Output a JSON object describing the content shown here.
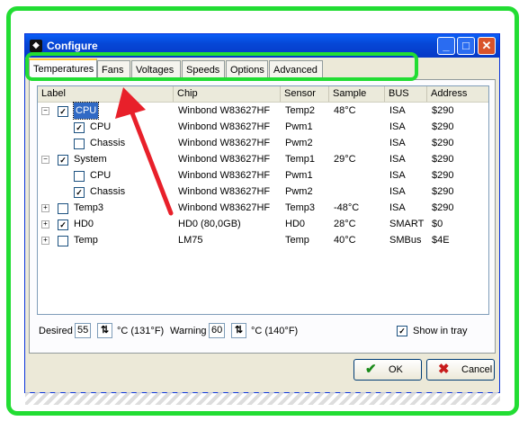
{
  "window": {
    "title": "Configure",
    "minimize": "_",
    "maximize": "□",
    "close": "✕"
  },
  "tabs": [
    "Temperatures",
    "Fans",
    "Voltages",
    "Speeds",
    "Options",
    "Advanced"
  ],
  "active_tab": "Temperatures",
  "columns": [
    "Label",
    "Chip",
    "Sensor",
    "Sample",
    "BUS",
    "Address"
  ],
  "rows": [
    {
      "label": "CPU",
      "level": 0,
      "expander": "−",
      "checked": true,
      "selected": true,
      "chip": "Winbond W83627HF",
      "sensor": "Temp2",
      "sample": "48°C",
      "bus": "ISA",
      "address": "$290"
    },
    {
      "label": "CPU",
      "level": 1,
      "expander": "",
      "checked": true,
      "selected": false,
      "chip": "Winbond W83627HF",
      "sensor": "Pwm1",
      "sample": "",
      "bus": "ISA",
      "address": "$290"
    },
    {
      "label": "Chassis",
      "level": 1,
      "expander": "",
      "checked": false,
      "selected": false,
      "chip": "Winbond W83627HF",
      "sensor": "Pwm2",
      "sample": "",
      "bus": "ISA",
      "address": "$290"
    },
    {
      "label": "System",
      "level": 0,
      "expander": "−",
      "checked": true,
      "selected": false,
      "chip": "Winbond W83627HF",
      "sensor": "Temp1",
      "sample": "29°C",
      "bus": "ISA",
      "address": "$290"
    },
    {
      "label": "CPU",
      "level": 1,
      "expander": "",
      "checked": false,
      "selected": false,
      "chip": "Winbond W83627HF",
      "sensor": "Pwm1",
      "sample": "",
      "bus": "ISA",
      "address": "$290"
    },
    {
      "label": "Chassis",
      "level": 1,
      "expander": "",
      "checked": true,
      "selected": false,
      "chip": "Winbond W83627HF",
      "sensor": "Pwm2",
      "sample": "",
      "bus": "ISA",
      "address": "$290"
    },
    {
      "label": "Temp3",
      "level": 0,
      "expander": "+",
      "checked": false,
      "selected": false,
      "chip": "Winbond W83627HF",
      "sensor": "Temp3",
      "sample": "-48°C",
      "bus": "ISA",
      "address": "$290"
    },
    {
      "label": "HD0",
      "level": 0,
      "expander": "+",
      "checked": true,
      "selected": false,
      "chip": "HD0 (80,0GB)",
      "sensor": "HD0",
      "sample": "28°C",
      "bus": "SMART",
      "address": "$0"
    },
    {
      "label": "Temp",
      "level": 0,
      "expander": "+",
      "checked": false,
      "selected": false,
      "chip": "LM75",
      "sensor": "Temp",
      "sample": "40°C",
      "bus": "SMBus",
      "address": "$4E"
    }
  ],
  "settings": {
    "desired_label": "Desired",
    "desired_value": "55",
    "desired_unit": "°C (131°F)",
    "warning_label": "Warning",
    "warning_value": "60",
    "warning_unit": "°C (140°F)",
    "show_in_tray_label": "Show in tray",
    "show_in_tray": true
  },
  "buttons": {
    "ok": "OK",
    "cancel": "Cancel"
  },
  "colors": {
    "highlight": "#22dd33",
    "arrow": "#e8202a",
    "selection": "#316ac5"
  }
}
